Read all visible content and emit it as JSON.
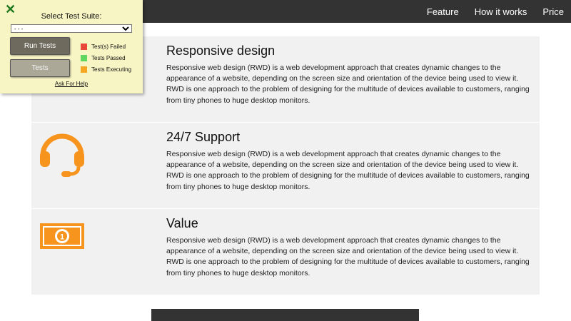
{
  "nav": {
    "links": [
      "Feature",
      "How it works",
      "Price"
    ]
  },
  "features": [
    {
      "icon": "monitor-icon",
      "title": "Responsive design",
      "text": "Responsive web design (RWD) is a web development approach that creates dynamic changes to the appearance of a website, depending on the screen size and orientation of the device being used to view it. RWD is one approach to the problem of designing for the multitude of devices available to customers, ranging from tiny phones to huge desktop monitors."
    },
    {
      "icon": "headset-icon",
      "title": "24/7 Support",
      "text": "Responsive web design (RWD) is a web development approach that creates dynamic changes to the appearance of a website, depending on the screen size and orientation of the device being used to view it. RWD is one approach to the problem of designing for the multitude of devices available to customers, ranging from tiny phones to huge desktop monitors."
    },
    {
      "icon": "banknote-icon",
      "title": "Value",
      "text": "Responsive web design (RWD) is a web development approach that creates dynamic changes to the appearance of a website, depending on the screen size and orientation of the device being used to view it. RWD is one approach to the problem of designing for the multitude of devices available to customers, ranging from tiny phones to huge desktop monitors."
    }
  ],
  "test_panel": {
    "close_label": "✕",
    "title": "Select Test Suite:",
    "select_value": "- - -",
    "run_label": "Run Tests",
    "tests_label": "Tests",
    "legend": [
      {
        "label": "Test(s) Failed",
        "color": "#e8473a"
      },
      {
        "label": "Tests Passed",
        "color": "#5fd65f"
      },
      {
        "label": "Tests Executing",
        "color": "#f5a623"
      }
    ],
    "help_label": "Ask For Help"
  },
  "colors": {
    "accent": "#f7941d",
    "navbar": "#333333"
  }
}
